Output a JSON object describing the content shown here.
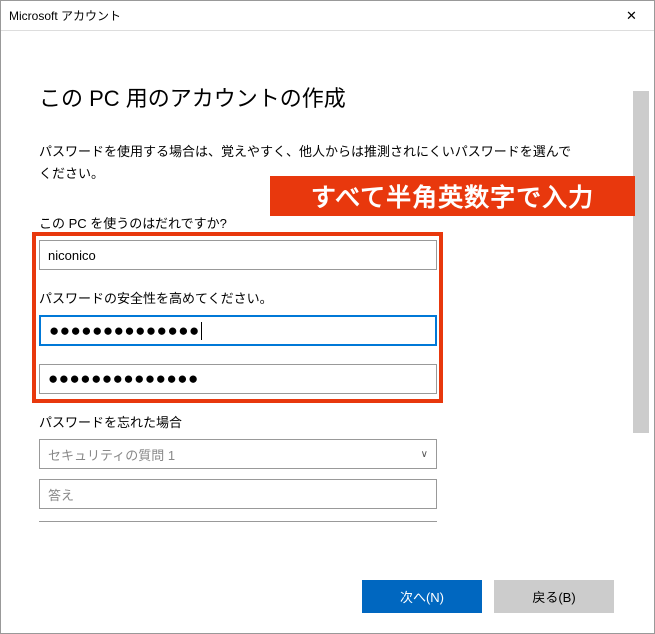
{
  "titlebar": {
    "title": "Microsoft アカウント"
  },
  "page": {
    "heading": "この PC 用のアカウントの作成",
    "description": "パスワードを使用する場合は、覚えやすく、他人からは推測されにくいパスワードを選んでください。"
  },
  "annotation": {
    "banner": "すべて半角英数字で入力"
  },
  "form": {
    "username_label": "この PC を使うのはだれですか?",
    "username_value": "niconico",
    "password_label": "パスワードの安全性を高めてください。",
    "password_value": "●●●●●●●●●●●●●●",
    "password_confirm_value": "●●●●●●●●●●●●●●",
    "forgot_label": "パスワードを忘れた場合",
    "security_question_placeholder": "セキュリティの質問 1",
    "answer_placeholder": "答え"
  },
  "buttons": {
    "next": "次へ(N)",
    "back": "戻る(B)"
  }
}
